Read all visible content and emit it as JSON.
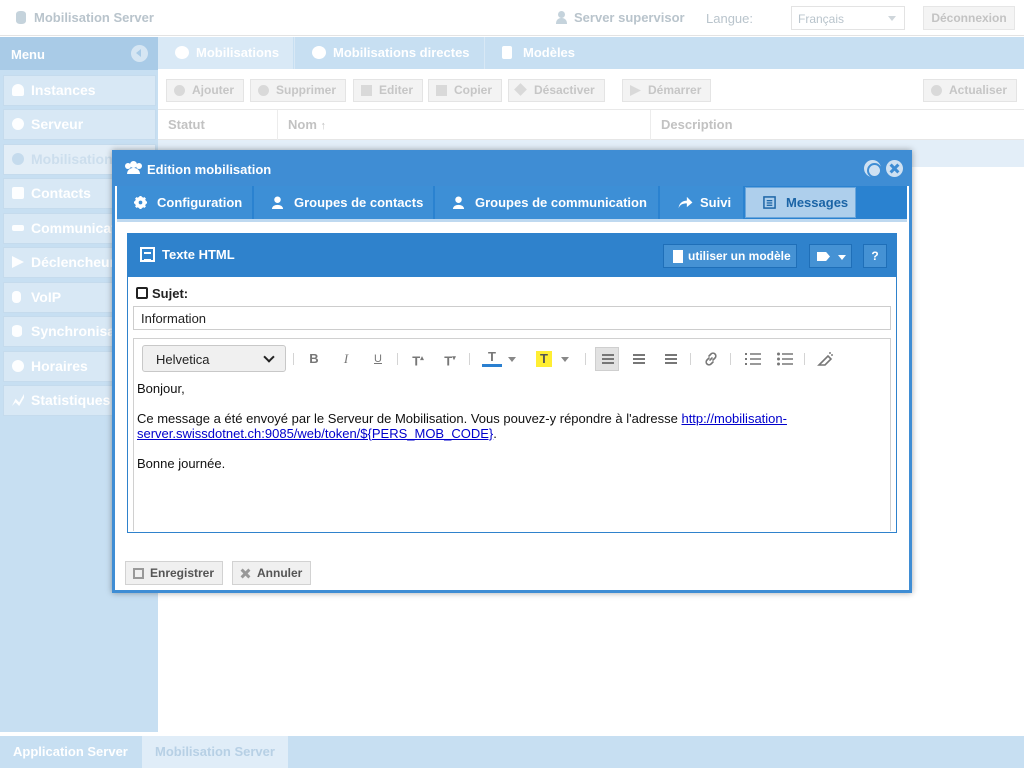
{
  "top": {
    "app_title": "Mobilisation Server",
    "user": "Server supervisor",
    "lang_label": "Langue:",
    "lang_value": "Français",
    "logout": "Déconnexion"
  },
  "sidebar": {
    "title": "Menu",
    "items": [
      {
        "label": "Instances",
        "icon": "bell-icon"
      },
      {
        "label": "Serveur",
        "icon": "gear-icon"
      },
      {
        "label": "Mobilisations",
        "icon": "users-icon"
      },
      {
        "label": "Contacts",
        "icon": "address-book-icon"
      },
      {
        "label": "Communications",
        "icon": "exchange-icon"
      },
      {
        "label": "Déclencheurs",
        "icon": "play-icon"
      },
      {
        "label": "VoIP",
        "icon": "phone-icon"
      },
      {
        "label": "Synchronisation",
        "icon": "database-icon"
      },
      {
        "label": "Horaires",
        "icon": "clock-icon"
      },
      {
        "label": "Statistiques",
        "icon": "chart-icon"
      }
    ]
  },
  "main": {
    "tabs": [
      "Mobilisations",
      "Mobilisations directes",
      "Modèles"
    ],
    "toolbar": {
      "add": "Ajouter",
      "delete": "Supprimer",
      "edit": "Editer",
      "copy": "Copier",
      "disable": "Désactiver",
      "start": "Démarrer",
      "refresh": "Actualiser"
    },
    "columns": [
      "Statut",
      "Nom",
      "Description"
    ]
  },
  "bottom": {
    "tabs": [
      "Application Server",
      "Mobilisation Server"
    ]
  },
  "modal": {
    "title": "Edition mobilisation",
    "tabs": [
      "Configuration",
      "Groupes de contacts",
      "Groupes de communication",
      "Suivi",
      "Messages"
    ],
    "panel_title": "Texte HTML",
    "use_model": "utiliser un modèle",
    "help": "?",
    "subject_label": "Sujet:",
    "subject_value": "Information",
    "font": "Helvetica",
    "body": {
      "greeting": "Bonjour,",
      "text": "Ce message a été envoyé par le Serveur de Mobilisation. Vous pouvez-y répondre à l'adresse ",
      "link": "http://mobilisation-server.swissdotnet.ch:9085/web/token/${PERS_MOB_CODE}",
      "after_link": ".",
      "closing": "Bonne journée."
    },
    "save": "Enregistrer",
    "cancel": "Annuler"
  },
  "colors": {
    "accent": "#3f8dd4",
    "sidebar": "#c7dff2",
    "highlight": "#ffee33"
  }
}
